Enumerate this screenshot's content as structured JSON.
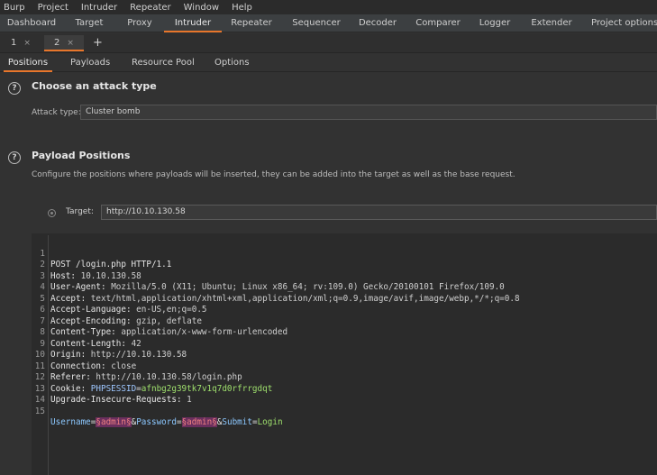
{
  "menu": [
    "Burp",
    "Project",
    "Intruder",
    "Repeater",
    "Window",
    "Help"
  ],
  "main_tabs": [
    "Dashboard",
    "Target",
    "Proxy",
    "Intruder",
    "Repeater",
    "Sequencer",
    "Decoder",
    "Comparer",
    "Logger",
    "Extender",
    "Project options"
  ],
  "active_main_tab": "Intruder",
  "attack_tabs": [
    {
      "label": "1",
      "close": "×"
    },
    {
      "label": "2",
      "close": "×"
    }
  ],
  "add_tab": "+",
  "config_tabs": [
    "Positions",
    "Payloads",
    "Resource Pool",
    "Options"
  ],
  "attack_type": {
    "heading": "Choose an attack type",
    "label": "Attack type:",
    "value": "Cluster bomb"
  },
  "payload_positions": {
    "heading": "Payload Positions",
    "description": "Configure the positions where payloads will be inserted, they can be added into the target as well as the base request."
  },
  "target": {
    "label": "Target:",
    "value": "http://10.10.130.58"
  },
  "request": {
    "line1": "POST /login.php HTTP/1.1",
    "headers": [
      {
        "name": "Host",
        "value": "10.10.130.58"
      },
      {
        "name": "User-Agent",
        "value": "Mozilla/5.0 (X11; Ubuntu; Linux x86_64; rv:109.0) Gecko/20100101 Firefox/109.0"
      },
      {
        "name": "Accept",
        "value": "text/html,application/xhtml+xml,application/xml;q=0.9,image/avif,image/webp,*/*;q=0.8"
      },
      {
        "name": "Accept-Language",
        "value": "en-US,en;q=0.5"
      },
      {
        "name": "Accept-Encoding",
        "value": "gzip, deflate"
      },
      {
        "name": "Content-Type",
        "value": "application/x-www-form-urlencoded"
      },
      {
        "name": "Content-Length",
        "value": "42"
      },
      {
        "name": "Origin",
        "value": "http://10.10.130.58"
      },
      {
        "name": "Connection",
        "value": "close"
      },
      {
        "name": "Referer",
        "value": "http://10.10.130.58/login.php"
      }
    ],
    "cookie": {
      "name": "Cookie",
      "key": "PHPSESSID",
      "value": "afnbg2g39tk7v1q7d0rfrrgdqt"
    },
    "upgrade": {
      "name": "Upgrade-Insecure-Requests",
      "value": "1"
    },
    "body": {
      "p1_name": "Username",
      "p1_value": "§admin§",
      "p2_name": "Password",
      "p2_value": "§admin§",
      "p3_name": "Submit",
      "p3_value": "Login"
    },
    "line_numbers": [
      "1",
      "2",
      "3",
      "4",
      "5",
      "6",
      "7",
      "8",
      "9",
      "10",
      "11",
      "12",
      "13",
      "14",
      "15"
    ]
  },
  "colors": {
    "accent": "#e8762b",
    "payload_marker_bg": "#6b2f5e",
    "cookie_value": "#9fe06d"
  }
}
